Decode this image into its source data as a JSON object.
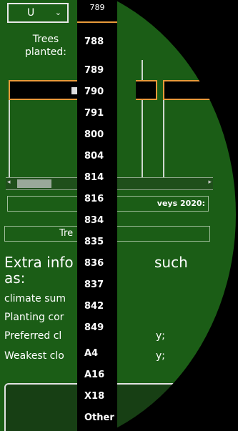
{
  "top_select": {
    "value": "U",
    "chevron": "⌄"
  },
  "trees_label": {
    "line1": "Trees",
    "line2": "planted:"
  },
  "surveys_button": {
    "label": "veys 2020:"
  },
  "tre_button": {
    "label": "Tre"
  },
  "extra_heading": {
    "part1": "Extra info",
    "part2": "such",
    "part3": "as:"
  },
  "info_lines": [
    "climate sum",
    "Planting cor",
    "Preferred cl",
    "Weakest clo"
  ],
  "info_tails": [
    "y;",
    "y;"
  ],
  "dropdown": {
    "top_item": "789",
    "items": [
      "788",
      "789",
      "790",
      "791",
      "800",
      "804",
      "814",
      "816",
      "834",
      "835",
      "836",
      "837",
      "842",
      "849",
      "A4",
      "A16",
      "X18",
      "Other"
    ]
  },
  "colors": {
    "panel_green": "#1b5d16",
    "accent_orange": "#e89a3a"
  }
}
